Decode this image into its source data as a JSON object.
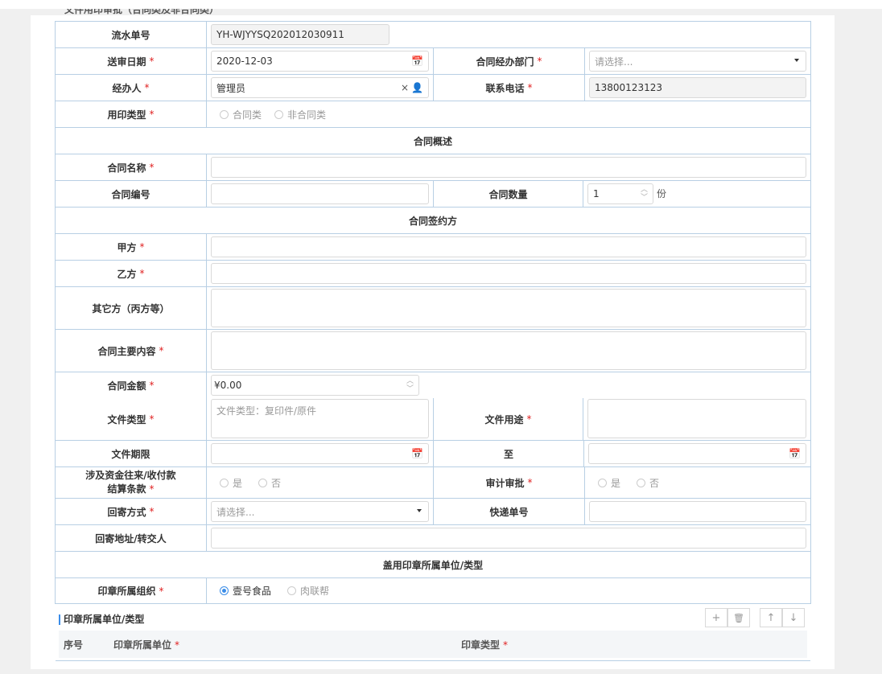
{
  "header": {
    "clipped_title": "文件用印审批（合同类及非合同类）"
  },
  "form": {
    "serial_label": "流水单号",
    "serial_value": "YH-WJYYSQ202012030911",
    "send_date_label": "送审日期",
    "send_date_value": "2020-12-03",
    "dept_label": "合同经办部门",
    "dept_placeholder": "请选择...",
    "handler_label": "经办人",
    "handler_value": "管理员",
    "phone_label": "联系电话",
    "phone_value": "13800123123",
    "seal_type_label": "用印类型",
    "seal_type_options": [
      "合同类",
      "非合同类"
    ],
    "section_overview": "合同概述",
    "contract_name_label": "合同名称",
    "contract_no_label": "合同编号",
    "contract_qty_label": "合同数量",
    "contract_qty_value": "1",
    "contract_qty_unit": "份",
    "section_parties": "合同签约方",
    "party_a_label": "甲方",
    "party_b_label": "乙方",
    "other_party_label": "其它方（丙方等）",
    "main_content_label": "合同主要内容",
    "amount_label": "合同金额",
    "amount_value": "¥0.00",
    "doc_type_label": "文件类型",
    "doc_type_placeholder": "文件类型：复印件/原件",
    "doc_use_label": "文件用途",
    "doc_period_label": "文件期限",
    "to_label": "至",
    "funds_label_1": "涉及资金往来/收付款",
    "funds_label_2": "结算条款",
    "funds_options": [
      "是",
      "否"
    ],
    "audit_label": "审计审批",
    "audit_options": [
      "是",
      "否"
    ],
    "return_method_label": "回寄方式",
    "return_method_placeholder": "请选择...",
    "express_no_label": "快递单号",
    "return_addr_label": "回寄地址/转交人",
    "section_seal_unit": "盖用印章所属单位/类型",
    "seal_org_label": "印章所属组织",
    "seal_org_options": [
      "壹号食品",
      "肉联帮"
    ],
    "required_mark": "*"
  },
  "subtable": {
    "title": "印章所属单位/类型",
    "col_index": "序号",
    "col_unit": "印章所属单位",
    "col_type": "印章类型",
    "add_icon": "+",
    "delete_icon": "🗑",
    "up_icon": "↑",
    "down_icon": "↓"
  },
  "icons": {
    "calendar": "📅",
    "clear": "×",
    "user": "👤",
    "spin_up": "︿",
    "spin_down": "﹀"
  }
}
